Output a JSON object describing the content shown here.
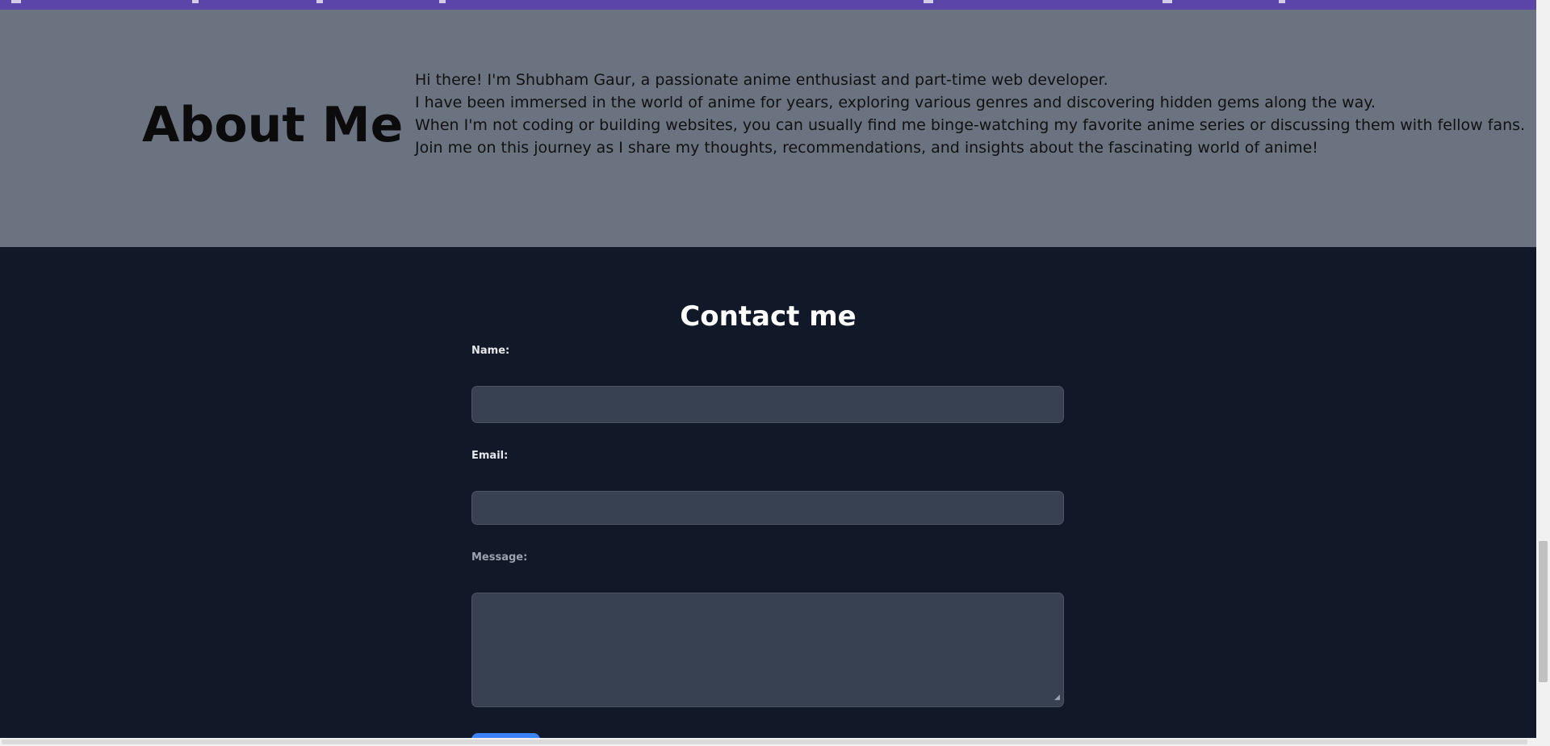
{
  "about": {
    "title": "About Me",
    "paragraphs": [
      "Hi there! I'm Shubham Gaur, a passionate anime enthusiast and part-time web developer.",
      "I have been immersed in the world of anime for years, exploring various genres and discovering hidden gems along the way.",
      "When I'm not coding or building websites, you can usually find me binge-watching my favorite anime series or discussing them with fellow fans.",
      "Join me on this journey as I share my thoughts, recommendations, and insights about the fascinating world of anime!"
    ]
  },
  "contact": {
    "title": "Contact me",
    "name_label": "Name:",
    "name_value": "",
    "email_label": "Email:",
    "email_value": "",
    "message_label": "Message:",
    "message_value": "",
    "submit_label": ""
  },
  "colors": {
    "nav_bar": "#5b45a8",
    "about_background": "#6b7280",
    "contact_background": "#111827",
    "input_background": "#374151",
    "submit_button": "#3b82f6"
  }
}
